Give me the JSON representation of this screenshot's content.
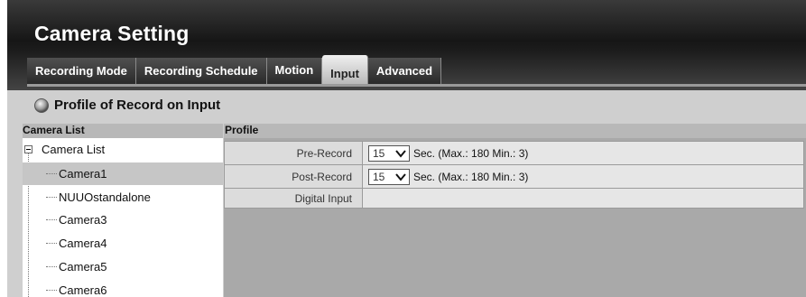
{
  "header": {
    "title": "Camera Setting"
  },
  "tabs": [
    {
      "label": "Recording Mode"
    },
    {
      "label": "Recording Schedule"
    },
    {
      "label": "Motion"
    },
    {
      "label": "Input",
      "active": true
    },
    {
      "label": "Advanced"
    }
  ],
  "section": {
    "title": "Profile of Record on Input",
    "icon": "record-profile-icon"
  },
  "columns": {
    "camera_list": "Camera List",
    "profile": "Profile"
  },
  "camera_tree": {
    "root": "Camera List",
    "items": [
      "Camera1",
      "NUUOstandalone",
      "Camera3",
      "Camera4",
      "Camera5",
      "Camera6"
    ],
    "selected": "Camera1"
  },
  "profile": {
    "pre_record": {
      "label": "Pre-Record",
      "value": "15",
      "hint": "Sec. (Max.: 180 Min.: 3)"
    },
    "post_record": {
      "label": "Post-Record",
      "value": "15",
      "hint": "Sec. (Max.: 180 Min.: 3)"
    },
    "digital_input": {
      "label": "Digital Input"
    }
  },
  "colors": {
    "header_dark": "#161616",
    "active_tab": "#d8d8d8",
    "selected_row": "#c6c6c6",
    "profile_bg": "#a9a9a9"
  }
}
